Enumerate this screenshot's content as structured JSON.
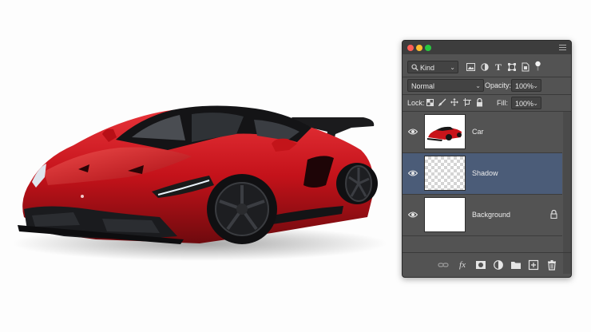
{
  "scene": {
    "subject": "car-photo",
    "body_color": "#c8141a"
  },
  "panel": {
    "search": {
      "kind_label": "Kind"
    },
    "filter_icons": [
      "image-filter-icon",
      "adjustment-filter-icon",
      "type-filter-icon",
      "shape-filter-icon",
      "smart-object-filter-icon"
    ],
    "blend_mode": "Normal",
    "opacity_label": "Opacity:",
    "opacity_value": "100%",
    "lock_label": "Lock:",
    "fill_label": "Fill:",
    "fill_value": "100%",
    "layers": [
      {
        "name": "Car",
        "visible": true,
        "selected": false,
        "thumbnail": "car"
      },
      {
        "name": "Shadow",
        "visible": true,
        "selected": true,
        "thumbnail": "transparent"
      },
      {
        "name": "Background",
        "visible": true,
        "selected": false,
        "thumbnail": "white",
        "locked": true
      }
    ],
    "bottom_icons": [
      "link-layers-icon",
      "fx-icon",
      "add-mask-icon",
      "adjustment-layer-icon",
      "new-group-icon",
      "new-layer-icon",
      "delete-layer-icon"
    ],
    "fx_label": "fx",
    "selection_color": "#4b5c78"
  }
}
